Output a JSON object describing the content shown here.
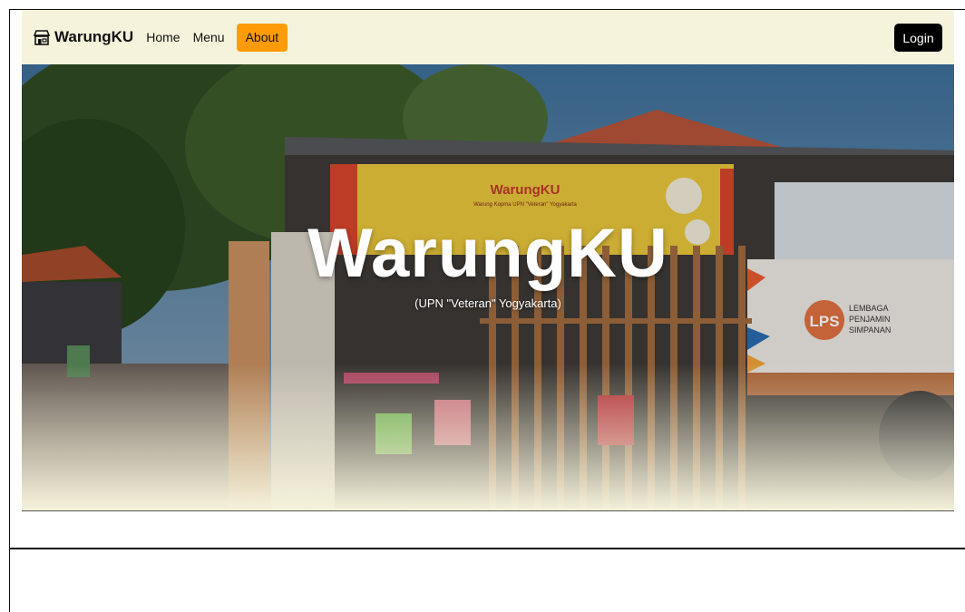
{
  "navbar": {
    "brand": "WarungKU",
    "links": [
      {
        "label": "Home"
      },
      {
        "label": "Menu"
      }
    ],
    "active_link": "About",
    "active_color": "#fe9b06",
    "login_label": "Login"
  },
  "hero": {
    "title": "WarungKU",
    "subtitle": "(UPN \"Veteran\" Yogyakarta)",
    "banner": {
      "brand": "WarungKU",
      "tagline": "Warung Kopma UPN \"Veteran\" Yogyakarta"
    },
    "sign": {
      "logo": "LPS",
      "lines": [
        "LEMBAGA",
        "PENJAMIN",
        "SIMPANAN"
      ]
    }
  },
  "colors": {
    "page_bg": "#f6f3dc",
    "login_bg": "#000000"
  }
}
